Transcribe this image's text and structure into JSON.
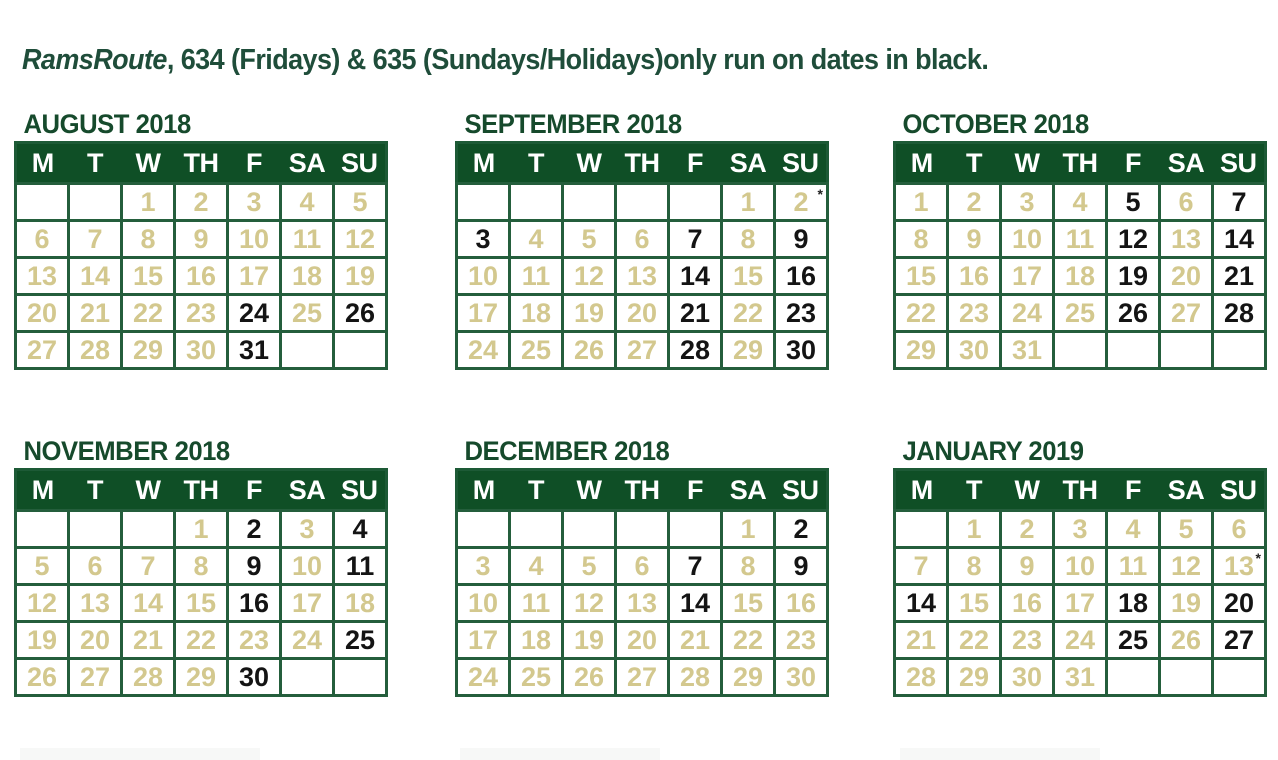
{
  "title": {
    "route_name": "RamsRoute",
    "text": ", 634 (Fridays) & 635 (Sundays/Holidays)only run on dates in black."
  },
  "weekday_headers": [
    "M",
    "T",
    "W",
    "TH",
    "F",
    "SA",
    "SU"
  ],
  "colors": {
    "header_bg": "#0f4f26",
    "grid_line": "#245e3c",
    "title_text": "#1f4d3a",
    "inactive_date_text": "#d3c88e",
    "inactive_date_bg": "#eef0ec",
    "active_date_text": "#141414"
  },
  "months": [
    {
      "name": "AUGUST 2018",
      "rows": [
        [
          null,
          null,
          {
            "d": "1",
            "s": "g"
          },
          {
            "d": "2",
            "s": "g"
          },
          {
            "d": "3",
            "s": "g"
          },
          {
            "d": "4",
            "s": "g"
          },
          {
            "d": "5",
            "s": "g"
          }
        ],
        [
          {
            "d": "6",
            "s": "g"
          },
          {
            "d": "7",
            "s": "g"
          },
          {
            "d": "8",
            "s": "g"
          },
          {
            "d": "9",
            "s": "g"
          },
          {
            "d": "10",
            "s": "g"
          },
          {
            "d": "11",
            "s": "g"
          },
          {
            "d": "12",
            "s": "g"
          }
        ],
        [
          {
            "d": "13",
            "s": "g"
          },
          {
            "d": "14",
            "s": "g"
          },
          {
            "d": "15",
            "s": "g"
          },
          {
            "d": "16",
            "s": "g"
          },
          {
            "d": "17",
            "s": "g"
          },
          {
            "d": "18",
            "s": "g"
          },
          {
            "d": "19",
            "s": "g"
          }
        ],
        [
          {
            "d": "20",
            "s": "g"
          },
          {
            "d": "21",
            "s": "g"
          },
          {
            "d": "22",
            "s": "g"
          },
          {
            "d": "23",
            "s": "g"
          },
          {
            "d": "24",
            "s": "b"
          },
          {
            "d": "25",
            "s": "g"
          },
          {
            "d": "26",
            "s": "b"
          }
        ],
        [
          {
            "d": "27",
            "s": "g"
          },
          {
            "d": "28",
            "s": "g"
          },
          {
            "d": "29",
            "s": "g"
          },
          {
            "d": "30",
            "s": "g"
          },
          {
            "d": "31",
            "s": "b"
          },
          null,
          null
        ]
      ]
    },
    {
      "name": "SEPTEMBER 2018",
      "rows": [
        [
          null,
          null,
          null,
          null,
          null,
          {
            "d": "1",
            "s": "g"
          },
          {
            "d": "2",
            "s": "g",
            "note": "*"
          }
        ],
        [
          {
            "d": "3",
            "s": "b"
          },
          {
            "d": "4",
            "s": "g"
          },
          {
            "d": "5",
            "s": "g"
          },
          {
            "d": "6",
            "s": "g"
          },
          {
            "d": "7",
            "s": "b"
          },
          {
            "d": "8",
            "s": "g"
          },
          {
            "d": "9",
            "s": "b"
          }
        ],
        [
          {
            "d": "10",
            "s": "g"
          },
          {
            "d": "11",
            "s": "g"
          },
          {
            "d": "12",
            "s": "g"
          },
          {
            "d": "13",
            "s": "g"
          },
          {
            "d": "14",
            "s": "b"
          },
          {
            "d": "15",
            "s": "g"
          },
          {
            "d": "16",
            "s": "b"
          }
        ],
        [
          {
            "d": "17",
            "s": "g"
          },
          {
            "d": "18",
            "s": "g"
          },
          {
            "d": "19",
            "s": "g"
          },
          {
            "d": "20",
            "s": "g"
          },
          {
            "d": "21",
            "s": "b"
          },
          {
            "d": "22",
            "s": "g"
          },
          {
            "d": "23",
            "s": "b"
          }
        ],
        [
          {
            "d": "24",
            "s": "g"
          },
          {
            "d": "25",
            "s": "g"
          },
          {
            "d": "26",
            "s": "g"
          },
          {
            "d": "27",
            "s": "g"
          },
          {
            "d": "28",
            "s": "b"
          },
          {
            "d": "29",
            "s": "g"
          },
          {
            "d": "30",
            "s": "b"
          }
        ]
      ]
    },
    {
      "name": "OCTOBER 2018",
      "rows": [
        [
          {
            "d": "1",
            "s": "g"
          },
          {
            "d": "2",
            "s": "g"
          },
          {
            "d": "3",
            "s": "g"
          },
          {
            "d": "4",
            "s": "g"
          },
          {
            "d": "5",
            "s": "b"
          },
          {
            "d": "6",
            "s": "g"
          },
          {
            "d": "7",
            "s": "b"
          }
        ],
        [
          {
            "d": "8",
            "s": "g"
          },
          {
            "d": "9",
            "s": "g"
          },
          {
            "d": "10",
            "s": "g"
          },
          {
            "d": "11",
            "s": "g"
          },
          {
            "d": "12",
            "s": "b"
          },
          {
            "d": "13",
            "s": "g"
          },
          {
            "d": "14",
            "s": "b"
          }
        ],
        [
          {
            "d": "15",
            "s": "g"
          },
          {
            "d": "16",
            "s": "g"
          },
          {
            "d": "17",
            "s": "g"
          },
          {
            "d": "18",
            "s": "g"
          },
          {
            "d": "19",
            "s": "b"
          },
          {
            "d": "20",
            "s": "g"
          },
          {
            "d": "21",
            "s": "b"
          }
        ],
        [
          {
            "d": "22",
            "s": "g"
          },
          {
            "d": "23",
            "s": "g"
          },
          {
            "d": "24",
            "s": "g"
          },
          {
            "d": "25",
            "s": "g"
          },
          {
            "d": "26",
            "s": "b"
          },
          {
            "d": "27",
            "s": "g"
          },
          {
            "d": "28",
            "s": "b"
          }
        ],
        [
          {
            "d": "29",
            "s": "g"
          },
          {
            "d": "30",
            "s": "g"
          },
          {
            "d": "31",
            "s": "g"
          },
          null,
          null,
          null,
          null
        ]
      ]
    },
    {
      "name": "NOVEMBER 2018",
      "rows": [
        [
          null,
          null,
          null,
          {
            "d": "1",
            "s": "g"
          },
          {
            "d": "2",
            "s": "b"
          },
          {
            "d": "3",
            "s": "g"
          },
          {
            "d": "4",
            "s": "b"
          }
        ],
        [
          {
            "d": "5",
            "s": "g"
          },
          {
            "d": "6",
            "s": "g"
          },
          {
            "d": "7",
            "s": "g"
          },
          {
            "d": "8",
            "s": "g"
          },
          {
            "d": "9",
            "s": "b"
          },
          {
            "d": "10",
            "s": "g"
          },
          {
            "d": "11",
            "s": "b"
          }
        ],
        [
          {
            "d": "12",
            "s": "g"
          },
          {
            "d": "13",
            "s": "g"
          },
          {
            "d": "14",
            "s": "g"
          },
          {
            "d": "15",
            "s": "g"
          },
          {
            "d": "16",
            "s": "b"
          },
          {
            "d": "17",
            "s": "g"
          },
          {
            "d": "18",
            "s": "g"
          }
        ],
        [
          {
            "d": "19",
            "s": "g"
          },
          {
            "d": "20",
            "s": "g"
          },
          {
            "d": "21",
            "s": "g"
          },
          {
            "d": "22",
            "s": "g"
          },
          {
            "d": "23",
            "s": "g"
          },
          {
            "d": "24",
            "s": "g"
          },
          {
            "d": "25",
            "s": "b"
          }
        ],
        [
          {
            "d": "26",
            "s": "g"
          },
          {
            "d": "27",
            "s": "g"
          },
          {
            "d": "28",
            "s": "g"
          },
          {
            "d": "29",
            "s": "g"
          },
          {
            "d": "30",
            "s": "b"
          },
          null,
          null
        ]
      ]
    },
    {
      "name": "DECEMBER 2018",
      "rows": [
        [
          null,
          null,
          null,
          null,
          null,
          {
            "d": "1",
            "s": "g"
          },
          {
            "d": "2",
            "s": "b"
          }
        ],
        [
          {
            "d": "3",
            "s": "g"
          },
          {
            "d": "4",
            "s": "g"
          },
          {
            "d": "5",
            "s": "g"
          },
          {
            "d": "6",
            "s": "g"
          },
          {
            "d": "7",
            "s": "b"
          },
          {
            "d": "8",
            "s": "g"
          },
          {
            "d": "9",
            "s": "b"
          }
        ],
        [
          {
            "d": "10",
            "s": "g"
          },
          {
            "d": "11",
            "s": "g"
          },
          {
            "d": "12",
            "s": "g"
          },
          {
            "d": "13",
            "s": "g"
          },
          {
            "d": "14",
            "s": "b"
          },
          {
            "d": "15",
            "s": "g"
          },
          {
            "d": "16",
            "s": "g"
          }
        ],
        [
          {
            "d": "17",
            "s": "g"
          },
          {
            "d": "18",
            "s": "g"
          },
          {
            "d": "19",
            "s": "g"
          },
          {
            "d": "20",
            "s": "g"
          },
          {
            "d": "21",
            "s": "g"
          },
          {
            "d": "22",
            "s": "g"
          },
          {
            "d": "23",
            "s": "g"
          }
        ],
        [
          {
            "d": "24",
            "s": "g"
          },
          {
            "d": "25",
            "s": "g"
          },
          {
            "d": "26",
            "s": "g"
          },
          {
            "d": "27",
            "s": "g"
          },
          {
            "d": "28",
            "s": "g"
          },
          {
            "d": "29",
            "s": "g"
          },
          {
            "d": "30",
            "s": "g"
          }
        ]
      ]
    },
    {
      "name": "JANUARY 2019",
      "rows": [
        [
          null,
          {
            "d": "1",
            "s": "g"
          },
          {
            "d": "2",
            "s": "g"
          },
          {
            "d": "3",
            "s": "g"
          },
          {
            "d": "4",
            "s": "g"
          },
          {
            "d": "5",
            "s": "g"
          },
          {
            "d": "6",
            "s": "g"
          }
        ],
        [
          {
            "d": "7",
            "s": "g"
          },
          {
            "d": "8",
            "s": "g"
          },
          {
            "d": "9",
            "s": "g"
          },
          {
            "d": "10",
            "s": "g"
          },
          {
            "d": "11",
            "s": "g"
          },
          {
            "d": "12",
            "s": "g"
          },
          {
            "d": "13",
            "s": "g",
            "note": "*"
          }
        ],
        [
          {
            "d": "14",
            "s": "b"
          },
          {
            "d": "15",
            "s": "g"
          },
          {
            "d": "16",
            "s": "g"
          },
          {
            "d": "17",
            "s": "g"
          },
          {
            "d": "18",
            "s": "b"
          },
          {
            "d": "19",
            "s": "g"
          },
          {
            "d": "20",
            "s": "b"
          }
        ],
        [
          {
            "d": "21",
            "s": "g"
          },
          {
            "d": "22",
            "s": "g"
          },
          {
            "d": "23",
            "s": "g"
          },
          {
            "d": "24",
            "s": "g"
          },
          {
            "d": "25",
            "s": "b"
          },
          {
            "d": "26",
            "s": "g"
          },
          {
            "d": "27",
            "s": "b"
          }
        ],
        [
          {
            "d": "28",
            "s": "g"
          },
          {
            "d": "29",
            "s": "g"
          },
          {
            "d": "30",
            "s": "g"
          },
          {
            "d": "31",
            "s": "g"
          },
          null,
          null,
          null
        ]
      ]
    }
  ]
}
